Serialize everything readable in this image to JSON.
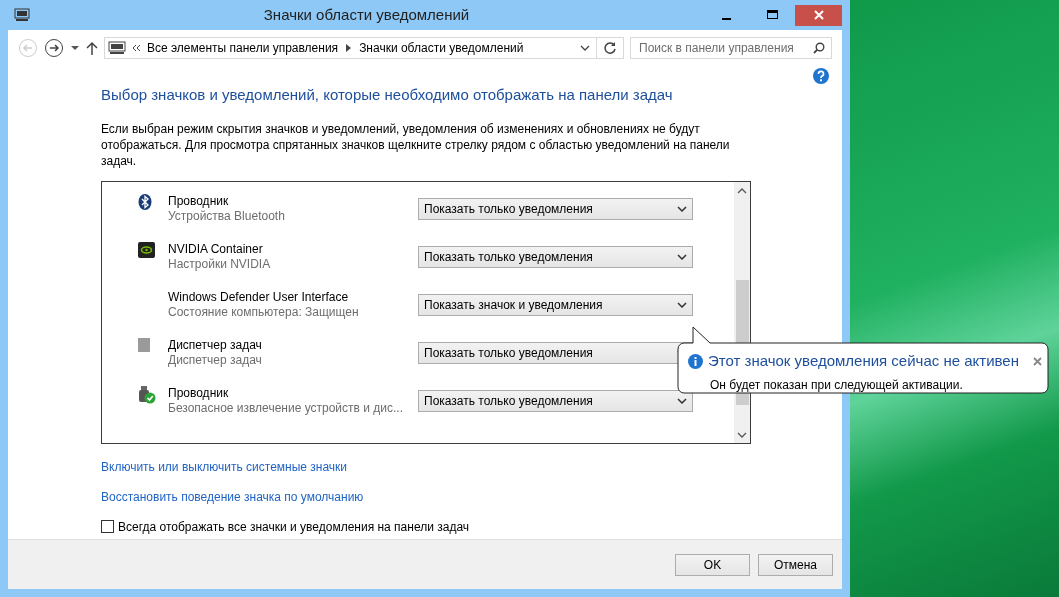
{
  "window": {
    "title": "Значки области уведомлений"
  },
  "address": {
    "crumbs": [
      "Все элементы панели управления",
      "Значки области уведомлений"
    ]
  },
  "search": {
    "placeholder": "Поиск в панели управления"
  },
  "heading": "Выбор значков и уведомлений, которые необходимо отображать на панели задач",
  "description": "Если выбран режим скрытия значков и уведомлений, уведомления об изменениях и обновлениях не будут отображаться. Для просмотра спрятанных значков щелкните стрелку рядом с областью уведомлений на панели задач.",
  "rows": [
    {
      "kind": "bluetooth",
      "name": "Проводник",
      "subtitle": "Устройства Bluetooth",
      "option": "Показать только уведомления"
    },
    {
      "kind": "nvidia",
      "name": "NVIDIA Container",
      "subtitle": "Настройки NVIDIA",
      "option": "Показать только уведомления"
    },
    {
      "kind": "none",
      "name": "Windows Defender User Interface",
      "subtitle": "Состояние компьютера: Защищен",
      "option": "Показать значок и уведомления"
    },
    {
      "kind": "square",
      "name": "Диспетчер задач",
      "subtitle": "Диспетчер задач",
      "option": "Показать только уведомления"
    },
    {
      "kind": "usb",
      "name": "Проводник",
      "subtitle": "Безопасное извлечение устройств и дис...",
      "option": "Показать только уведомления"
    }
  ],
  "tooltip": {
    "title": "Этот значок уведомления сейчас не активен",
    "text": "Он будет показан при следующей активации."
  },
  "links": [
    "Включить или выключить системные значки",
    "Восстановить поведение значка по умолчанию"
  ],
  "checkbox": {
    "label": "Всегда отображать все значки и уведомления на панели задач",
    "checked": false
  },
  "buttons": [
    "OK",
    "Отмена"
  ]
}
